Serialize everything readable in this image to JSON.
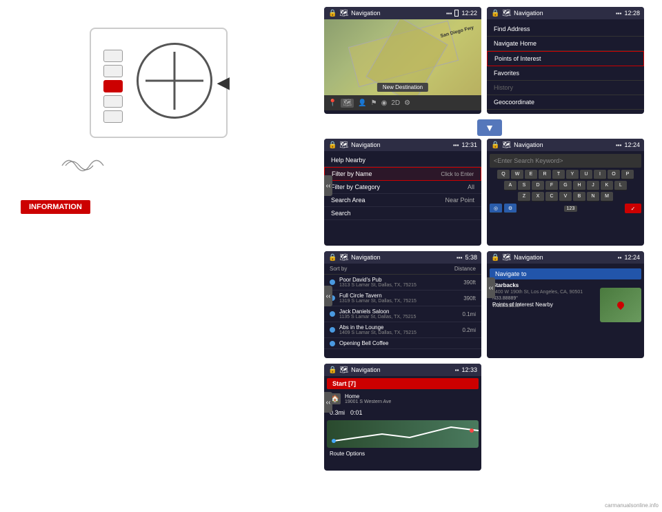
{
  "left_panel": {
    "info_label": "INFORMATION",
    "diagram_alt": "Steering wheel button diagram"
  },
  "screens": {
    "screen1": {
      "title": "Navigation",
      "time": "12:22",
      "new_destination": "New Destination",
      "map_alt": "Map view"
    },
    "screen2": {
      "title": "Navigation",
      "time": "12:28",
      "menu_items": [
        {
          "label": "Find Address",
          "highlighted": false
        },
        {
          "label": "Navigate Home",
          "highlighted": false
        },
        {
          "label": "Points of Interest",
          "highlighted": true
        },
        {
          "label": "Favorites",
          "highlighted": false
        },
        {
          "label": "History",
          "highlighted": false,
          "dimmed": true
        },
        {
          "label": "Geocoordinate",
          "highlighted": false
        }
      ]
    },
    "screen3": {
      "title": "Navigation",
      "time": "12:31",
      "rows": [
        {
          "label": "Help Nearby",
          "value": "",
          "highlighted": false
        },
        {
          "label": "Filter by Name",
          "value": "Click to Enter",
          "highlighted": true
        },
        {
          "label": "Filter by Category",
          "value": "All",
          "highlighted": false
        },
        {
          "label": "Search Area",
          "value": "Near Point",
          "highlighted": false
        },
        {
          "label": "Search",
          "value": "",
          "highlighted": false
        }
      ]
    },
    "screen4": {
      "title": "Navigation",
      "time": "12:24",
      "search_placeholder": "<Enter Search Keyword>",
      "keys_row1": [
        "Q",
        "W",
        "E",
        "R",
        "T",
        "Y",
        "U",
        "I",
        "O",
        "P"
      ],
      "keys_row2": [
        "A",
        "S",
        "D",
        "F",
        "G",
        "H",
        "J",
        "K",
        "L"
      ],
      "keys_row3": [
        "Z",
        "X",
        "C",
        "V",
        "B",
        "N",
        "M"
      ],
      "num_label": "123"
    },
    "screen5": {
      "title": "Navigation",
      "time": "5:38",
      "sort_by": "Sort by",
      "sort_value": "Distance",
      "results": [
        {
          "name": "Poor David's Pub",
          "address": "1313 S Lamar St, Dallas, TX, 75215",
          "dist": "390ft"
        },
        {
          "name": "Full Circle Tavern",
          "address": "1319 S Lamar St, Dallas, TX, 75215",
          "dist": "390ft"
        },
        {
          "name": "Jack Daniels Saloon",
          "address": "1135 S Lamar St, Dallas, TX, 75215",
          "dist": "0.1mi"
        },
        {
          "name": "Abs in the Lounge",
          "address": "1409 S Lamar St, Dallas, TX, 75215",
          "dist": "0.2mi"
        },
        {
          "name": "Opening Bell Coffee",
          "address": "",
          "dist": ""
        }
      ]
    },
    "screen6": {
      "title": "Navigation",
      "time": "12:24",
      "navigate_to": "Navigate to",
      "place_name": "Starbacks",
      "place_address": "1400 W 190th St, Los Angeles, CA, 90501",
      "coord1": "N33.88889°",
      "coord2": "W118.33333°",
      "poi_nearby": "Points of Interest Nearby"
    },
    "screen7": {
      "title": "Navigation",
      "time": "12:33",
      "start_label": "Start [7]",
      "home_label": "Home",
      "home_address": "19001 S Western Ave",
      "dist": "0.3mi",
      "time_val": "0:01",
      "route_options": "Route Options"
    }
  },
  "watermark": "carmanualsonline.info"
}
